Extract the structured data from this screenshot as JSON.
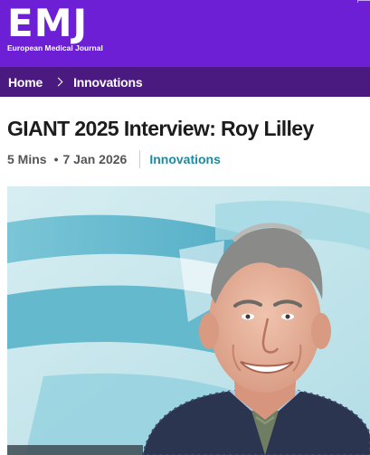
{
  "site": {
    "logo_mark": "EMJ",
    "logo_subtitle": "European Medical Journal"
  },
  "breadcrumb": {
    "items": [
      "Home",
      "Innovations"
    ]
  },
  "article": {
    "title": "GIANT 2025 Interview: Roy Lilley",
    "read_time": "5 Mins",
    "date": "7 Jan 2026",
    "category": "Innovations"
  },
  "colors": {
    "header_bg": "#6d1fd6",
    "breadcrumb_bg": "#4a1a80",
    "category_link": "#1e8aa0",
    "title_text": "#1c1c1c"
  },
  "icons": {
    "breadcrumb_separator": "chevron-right-icon"
  }
}
